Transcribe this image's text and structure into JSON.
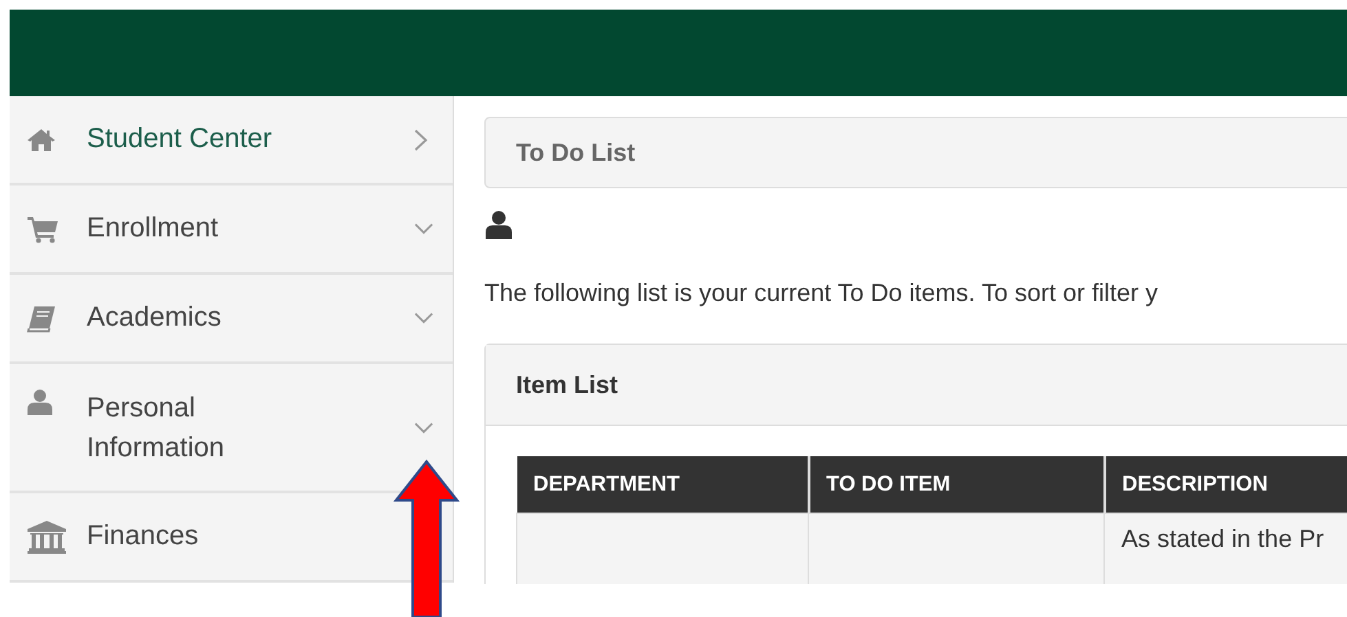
{
  "sidebar": {
    "items": [
      {
        "label": "Student Center",
        "selected": true
      },
      {
        "label": "Enrollment",
        "selected": false
      },
      {
        "label": "Academics",
        "selected": false
      },
      {
        "label": "Personal Information",
        "selected": false
      },
      {
        "label": "Finances",
        "selected": false
      }
    ]
  },
  "breadcrumb": {
    "title": "To Do List"
  },
  "intro": "The following list is your current To Do items. To sort or filter y",
  "panel": {
    "title": "Item List",
    "table": {
      "columns": [
        "DEPARTMENT",
        "TO DO ITEM",
        "DESCRIPTION"
      ],
      "rows": [
        [
          "",
          "",
          "As stated in the Pr"
        ]
      ]
    }
  },
  "annotation": {
    "kind": "arrow"
  }
}
